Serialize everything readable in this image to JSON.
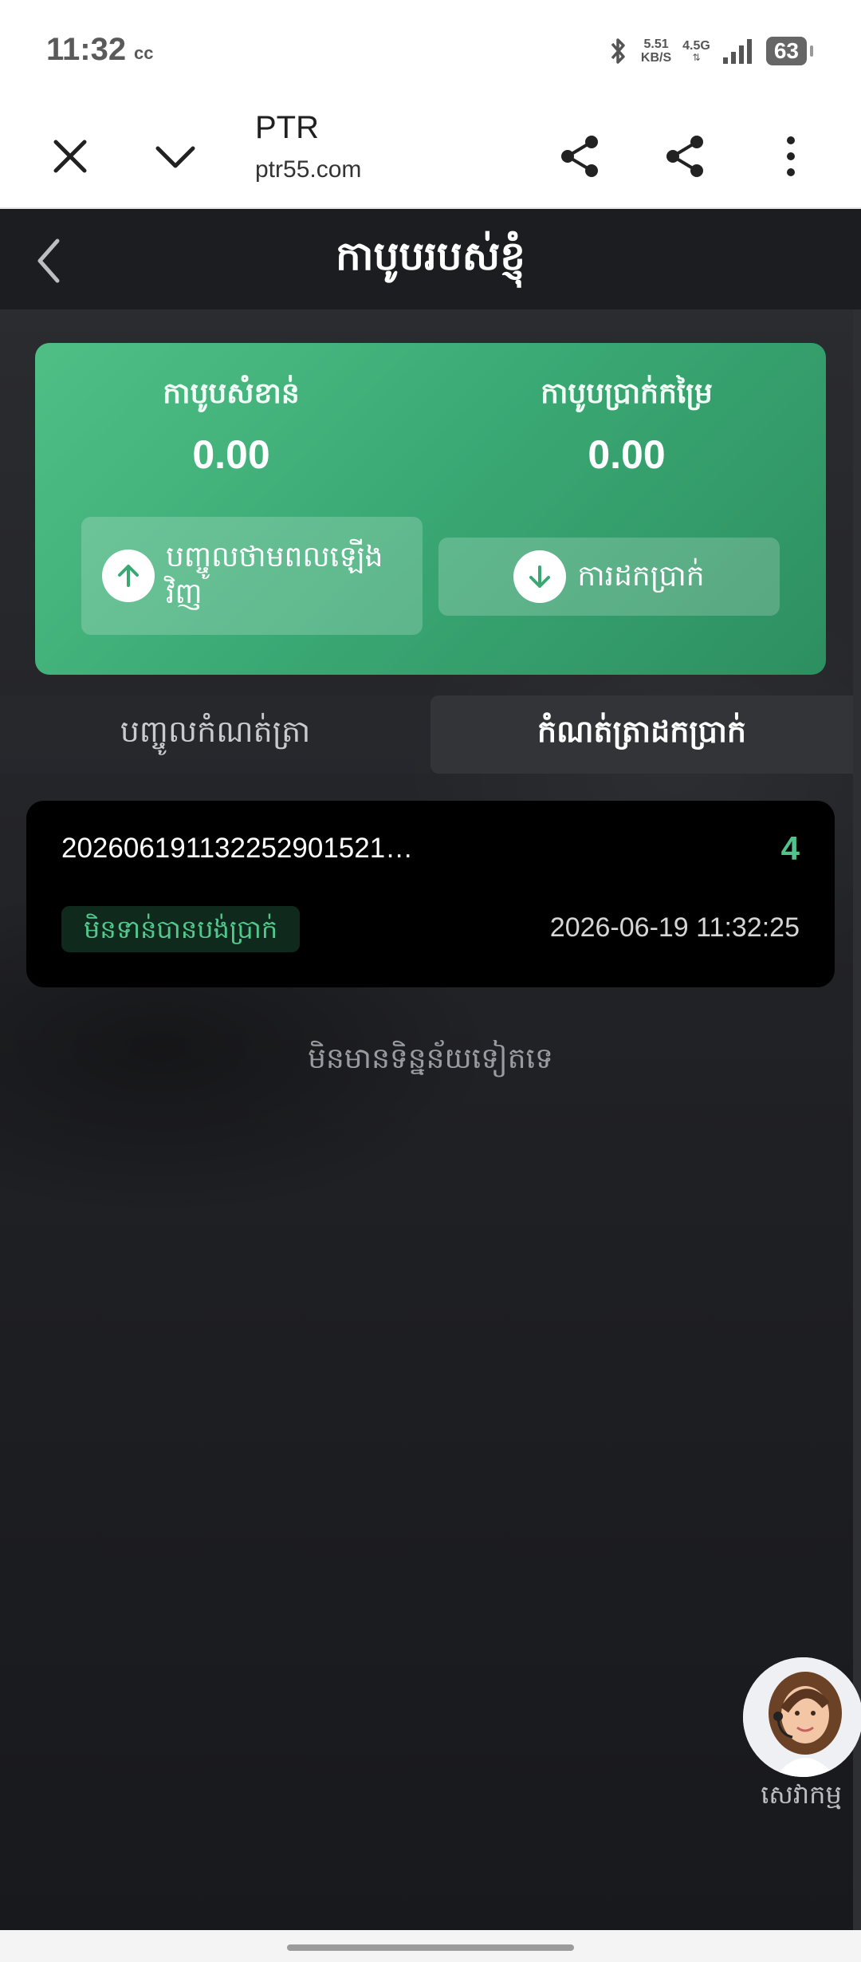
{
  "status_bar": {
    "time": "11:32",
    "cc": "cc",
    "net_speed_value": "5.51",
    "net_speed_unit": "KB/S",
    "net_type": "4.5G",
    "battery": "63"
  },
  "browser": {
    "title": "PTR",
    "url": "ptr55.com"
  },
  "header": {
    "title": "កាបូបរបស់ខ្ញុំ"
  },
  "wallet": {
    "main_label": "កាបូបសំខាន់",
    "main_value": "0.00",
    "commission_label": "កាបូបប្រាក់កម្រៃ",
    "commission_value": "0.00",
    "recharge_label": "បញ្ចូលថាមពលឡើងវិញ",
    "withdraw_label": "ការដកប្រាក់"
  },
  "tabs": [
    {
      "label": "បញ្ចូលកំណត់ត្រា"
    },
    {
      "label": "កំណត់ត្រាដកប្រាក់"
    }
  ],
  "records": [
    {
      "id": "20260619113225290152​1…",
      "amount": "4",
      "status": "មិនទាន់បានបង់ប្រាក់",
      "time": "2026-06-19 11:32:25"
    }
  ],
  "no_more_text": "មិនមានទិន្នន័យទៀតទេ",
  "service_label": "សេវាកម្ម",
  "colors": {
    "accent_green": "#4fc38a",
    "card_green": "#3aa873",
    "background": "#1b1b1f"
  }
}
